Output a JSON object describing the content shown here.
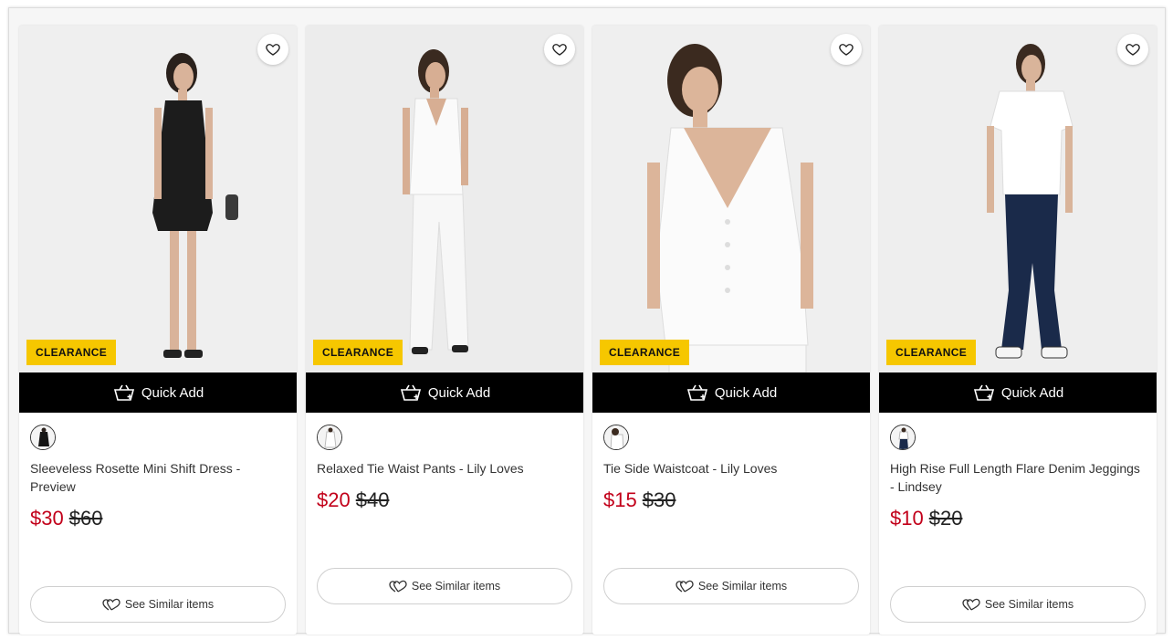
{
  "colors": {
    "badge": "#f6c700",
    "sale_price": "#c2001a",
    "quick_add_bg": "#000000"
  },
  "products": [
    {
      "badge": "CLEARANCE",
      "quick_add": "Quick Add",
      "title": "Sleeveless Rosette Mini Shift Dress - Preview",
      "price_now": "$30",
      "price_was": "$60",
      "similar": "See Similar items",
      "swatch": "black"
    },
    {
      "badge": "CLEARANCE",
      "quick_add": "Quick Add",
      "title": "Relaxed Tie Waist Pants - Lily Loves",
      "price_now": "$20",
      "price_was": "$40",
      "similar": "See Similar items",
      "swatch": "white"
    },
    {
      "badge": "CLEARANCE",
      "quick_add": "Quick Add",
      "title": "Tie Side Waistcoat - Lily Loves",
      "price_now": "$15",
      "price_was": "$30",
      "similar": "See Similar items",
      "swatch": "white"
    },
    {
      "badge": "CLEARANCE",
      "quick_add": "Quick Add",
      "title": "High Rise Full Length Flare Denim Jeggings - Lindsey",
      "price_now": "$10",
      "price_was": "$20",
      "similar": "See Similar items",
      "swatch": "white-denim"
    }
  ]
}
